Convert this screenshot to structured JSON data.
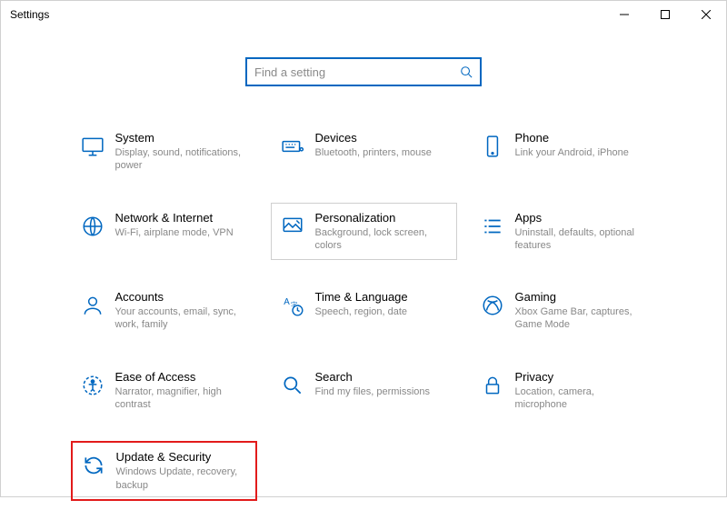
{
  "window": {
    "title": "Settings"
  },
  "search": {
    "placeholder": "Find a setting"
  },
  "tiles": {
    "system": {
      "title": "System",
      "desc": "Display, sound, notifications, power"
    },
    "devices": {
      "title": "Devices",
      "desc": "Bluetooth, printers, mouse"
    },
    "phone": {
      "title": "Phone",
      "desc": "Link your Android, iPhone"
    },
    "network": {
      "title": "Network & Internet",
      "desc": "Wi-Fi, airplane mode, VPN"
    },
    "personalization": {
      "title": "Personalization",
      "desc": "Background, lock screen, colors"
    },
    "apps": {
      "title": "Apps",
      "desc": "Uninstall, defaults, optional features"
    },
    "accounts": {
      "title": "Accounts",
      "desc": "Your accounts, email, sync, work, family"
    },
    "time": {
      "title": "Time & Language",
      "desc": "Speech, region, date"
    },
    "gaming": {
      "title": "Gaming",
      "desc": "Xbox Game Bar, captures, Game Mode"
    },
    "ease": {
      "title": "Ease of Access",
      "desc": "Narrator, magnifier, high contrast"
    },
    "search": {
      "title": "Search",
      "desc": "Find my files, permissions"
    },
    "privacy": {
      "title": "Privacy",
      "desc": "Location, camera, microphone"
    },
    "update": {
      "title": "Update & Security",
      "desc": "Windows Update, recovery, backup"
    }
  }
}
